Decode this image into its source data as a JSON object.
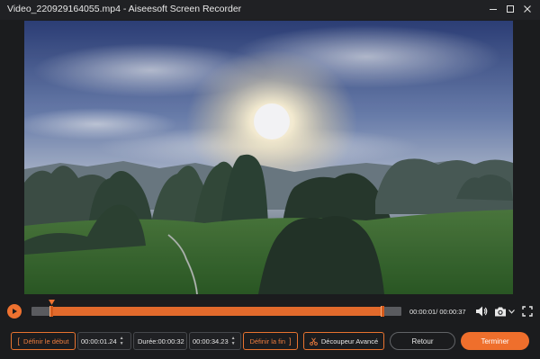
{
  "window": {
    "title": "Video_220929164055.mp4 - Aiseesoft Screen Recorder"
  },
  "player": {
    "time_display": "00:00:01/ 00:00:37"
  },
  "clip": {
    "set_start_label": "Définir le début",
    "start_time": "00:00:01.24",
    "duration_label": "Durée:",
    "duration_value": "00:00:32",
    "end_time": "00:00:34.23",
    "set_end_label": "Définir la fin",
    "advanced_cutter_label": "Découpeur Avancé"
  },
  "actions": {
    "back_label": "Retour",
    "finish_label": "Terminer"
  },
  "colors": {
    "accent": "#ef6f2c",
    "background": "#1b1c1e"
  },
  "icons": [
    "minimize-icon",
    "maximize-icon",
    "close-icon",
    "play-icon",
    "volume-icon",
    "camera-icon",
    "chevron-down-icon",
    "fullscreen-icon",
    "scissors-icon"
  ]
}
